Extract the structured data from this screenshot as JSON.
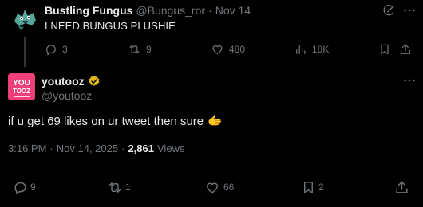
{
  "parent": {
    "display_name": "Bustling Fungus",
    "handle": "@Bungus_ror",
    "separator": "·",
    "time": "Nov 14",
    "text": "I NEED BUNGUS PLUSHIE",
    "stats": {
      "replies": "3",
      "reposts": "9",
      "likes": "480",
      "views": "18K"
    }
  },
  "main": {
    "display_name": "youtooz",
    "handle": "@youtooz",
    "avatar_lines": [
      "YOU",
      "TOOZ"
    ],
    "text": "if u get 69 likes on ur tweet then sure",
    "emoji": "🫱",
    "meta": {
      "time": "3:16 PM",
      "separator": "·",
      "date": "Nov 14, 2025",
      "separator2": "·",
      "views_count": "2,861",
      "views_label": "Views"
    },
    "stats": {
      "replies": "9",
      "reposts": "1",
      "likes": "66",
      "bookmarks": "2"
    }
  },
  "colors": {
    "background": "#000000",
    "text_primary": "#e7e9ea",
    "text_secondary": "#71767b",
    "divider": "#2f3336",
    "verified_gold": "#e2b719",
    "youtooz_pink": "#ee3f7c"
  },
  "icons": {
    "reply": "reply-icon",
    "repost": "repost-icon",
    "like": "heart-icon",
    "views": "views-icon",
    "bookmark": "bookmark-icon",
    "share": "share-icon",
    "more": "more-icon",
    "grok": "grok-icon",
    "verified": "verified-badge-icon"
  }
}
